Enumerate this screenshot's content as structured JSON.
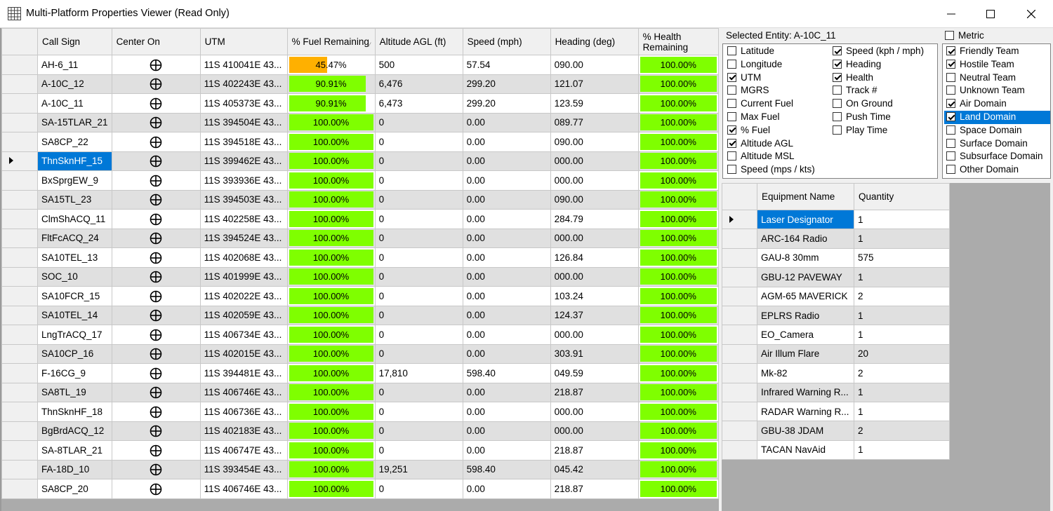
{
  "window": {
    "title": "Multi-Platform Properties Viewer (Read Only)"
  },
  "grid": {
    "columns": [
      "Call Sign",
      "Center On",
      "UTM",
      "% Fuel Remaining",
      "Altitude AGL (ft)",
      "Speed (mph)",
      "Heading (deg)",
      "% Health Remaining"
    ],
    "rows": [
      {
        "call": "AH-6_11",
        "utm": "11S 410041E 43...",
        "fuel_pct": 45.47,
        "fuel": "45.47%",
        "alt": "500",
        "speed": "57.54",
        "heading": "090.00",
        "health_pct": 100,
        "health": "100.00%"
      },
      {
        "call": "A-10C_12",
        "utm": "11S 402243E 43...",
        "fuel_pct": 90.91,
        "fuel": "90.91%",
        "alt": "6,476",
        "speed": "299.20",
        "heading": "121.07",
        "health_pct": 100,
        "health": "100.00%"
      },
      {
        "call": "A-10C_11",
        "utm": "11S 405373E 43...",
        "fuel_pct": 90.91,
        "fuel": "90.91%",
        "alt": "6,473",
        "speed": "299.20",
        "heading": "123.59",
        "health_pct": 100,
        "health": "100.00%"
      },
      {
        "call": "SA-15TLAR_21",
        "utm": "11S 394504E 43...",
        "fuel_pct": 100,
        "fuel": "100.00%",
        "alt": "0",
        "speed": "0.00",
        "heading": "089.77",
        "health_pct": 100,
        "health": "100.00%"
      },
      {
        "call": "SA8CP_22",
        "utm": "11S 394518E 43...",
        "fuel_pct": 100,
        "fuel": "100.00%",
        "alt": "0",
        "speed": "0.00",
        "heading": "090.00",
        "health_pct": 100,
        "health": "100.00%"
      },
      {
        "call": "ThnSknHF_15",
        "utm": "11S 399462E 43...",
        "fuel_pct": 100,
        "fuel": "100.00%",
        "alt": "0",
        "speed": "0.00",
        "heading": "000.00",
        "health_pct": 100,
        "health": "100.00%",
        "selected": true
      },
      {
        "call": "BxSprgEW_9",
        "utm": "11S 393936E 43...",
        "fuel_pct": 100,
        "fuel": "100.00%",
        "alt": "0",
        "speed": "0.00",
        "heading": "000.00",
        "health_pct": 100,
        "health": "100.00%"
      },
      {
        "call": "SA15TL_23",
        "utm": "11S 394503E 43...",
        "fuel_pct": 100,
        "fuel": "100.00%",
        "alt": "0",
        "speed": "0.00",
        "heading": "090.00",
        "health_pct": 100,
        "health": "100.00%"
      },
      {
        "call": "ClmShACQ_11",
        "utm": "11S 402258E 43...",
        "fuel_pct": 100,
        "fuel": "100.00%",
        "alt": "0",
        "speed": "0.00",
        "heading": "284.79",
        "health_pct": 100,
        "health": "100.00%"
      },
      {
        "call": "FltFcACQ_24",
        "utm": "11S 394524E 43...",
        "fuel_pct": 100,
        "fuel": "100.00%",
        "alt": "0",
        "speed": "0.00",
        "heading": "000.00",
        "health_pct": 100,
        "health": "100.00%"
      },
      {
        "call": "SA10TEL_13",
        "utm": "11S 402068E 43...",
        "fuel_pct": 100,
        "fuel": "100.00%",
        "alt": "0",
        "speed": "0.00",
        "heading": "126.84",
        "health_pct": 100,
        "health": "100.00%"
      },
      {
        "call": "SOC_10",
        "utm": "11S 401999E 43...",
        "fuel_pct": 100,
        "fuel": "100.00%",
        "alt": "0",
        "speed": "0.00",
        "heading": "000.00",
        "health_pct": 100,
        "health": "100.00%"
      },
      {
        "call": "SA10FCR_15",
        "utm": "11S 402022E 43...",
        "fuel_pct": 100,
        "fuel": "100.00%",
        "alt": "0",
        "speed": "0.00",
        "heading": "103.24",
        "health_pct": 100,
        "health": "100.00%"
      },
      {
        "call": "SA10TEL_14",
        "utm": "11S 402059E 43...",
        "fuel_pct": 100,
        "fuel": "100.00%",
        "alt": "0",
        "speed": "0.00",
        "heading": "124.37",
        "health_pct": 100,
        "health": "100.00%"
      },
      {
        "call": "LngTrACQ_17",
        "utm": "11S 406734E 43...",
        "fuel_pct": 100,
        "fuel": "100.00%",
        "alt": "0",
        "speed": "0.00",
        "heading": "000.00",
        "health_pct": 100,
        "health": "100.00%"
      },
      {
        "call": "SA10CP_16",
        "utm": "11S 402015E 43...",
        "fuel_pct": 100,
        "fuel": "100.00%",
        "alt": "0",
        "speed": "0.00",
        "heading": "303.91",
        "health_pct": 100,
        "health": "100.00%"
      },
      {
        "call": "F-16CG_9",
        "utm": "11S 394481E 43...",
        "fuel_pct": 100,
        "fuel": "100.00%",
        "alt": "17,810",
        "speed": "598.40",
        "heading": "049.59",
        "health_pct": 100,
        "health": "100.00%"
      },
      {
        "call": "SA8TL_19",
        "utm": "11S 406746E 43...",
        "fuel_pct": 100,
        "fuel": "100.00%",
        "alt": "0",
        "speed": "0.00",
        "heading": "218.87",
        "health_pct": 100,
        "health": "100.00%"
      },
      {
        "call": "ThnSknHF_18",
        "utm": "11S 406736E 43...",
        "fuel_pct": 100,
        "fuel": "100.00%",
        "alt": "0",
        "speed": "0.00",
        "heading": "000.00",
        "health_pct": 100,
        "health": "100.00%"
      },
      {
        "call": "BgBrdACQ_12",
        "utm": "11S 402183E 43...",
        "fuel_pct": 100,
        "fuel": "100.00%",
        "alt": "0",
        "speed": "0.00",
        "heading": "000.00",
        "health_pct": 100,
        "health": "100.00%"
      },
      {
        "call": "SA-8TLAR_21",
        "utm": "11S 406747E 43...",
        "fuel_pct": 100,
        "fuel": "100.00%",
        "alt": "0",
        "speed": "0.00",
        "heading": "218.87",
        "health_pct": 100,
        "health": "100.00%"
      },
      {
        "call": "FA-18D_10",
        "utm": "11S 393454E 43...",
        "fuel_pct": 100,
        "fuel": "100.00%",
        "alt": "19,251",
        "speed": "598.40",
        "heading": "045.42",
        "health_pct": 100,
        "health": "100.00%"
      },
      {
        "call": "SA8CP_20",
        "utm": "11S 406746E 43...",
        "fuel_pct": 100,
        "fuel": "100.00%",
        "alt": "0",
        "speed": "0.00",
        "heading": "218.87",
        "health_pct": 100,
        "health": "100.00%"
      }
    ]
  },
  "colors": {
    "bar_green": "#7fff00",
    "bar_low": "#ffb000",
    "selection": "#0078d7",
    "alt_row": "#e0e0e0",
    "grid_bg": "#ababab"
  },
  "icons": {
    "center_on": "crosshair-circle-icon",
    "app": "grid-window-icon"
  },
  "selected_entity": {
    "label": "Selected Entity: A-10C_11"
  },
  "metric": {
    "label": "Metric",
    "checked": false
  },
  "property_columns": [
    [
      {
        "label": "Latitude",
        "checked": false
      },
      {
        "label": "Longitude",
        "checked": false
      },
      {
        "label": "UTM",
        "checked": true
      },
      {
        "label": "MGRS",
        "checked": false
      },
      {
        "label": "Current Fuel",
        "checked": false
      },
      {
        "label": "Max Fuel",
        "checked": false
      },
      {
        "label": "% Fuel",
        "checked": true
      },
      {
        "label": "Altitude AGL",
        "checked": true
      },
      {
        "label": "Altitude MSL",
        "checked": false
      },
      {
        "label": "Speed (mps / kts)",
        "checked": false
      }
    ],
    [
      {
        "label": "Speed (kph / mph)",
        "checked": true
      },
      {
        "label": "Heading",
        "checked": true
      },
      {
        "label": "Health",
        "checked": true
      },
      {
        "label": "Track #",
        "checked": false
      },
      {
        "label": "On Ground",
        "checked": false
      },
      {
        "label": "Push Time",
        "checked": false
      },
      {
        "label": "Play Time",
        "checked": false
      }
    ]
  ],
  "domains": [
    {
      "label": "Friendly Team",
      "checked": true
    },
    {
      "label": "Hostile Team",
      "checked": true
    },
    {
      "label": "Neutral Team",
      "checked": false
    },
    {
      "label": "Unknown Team",
      "checked": false
    },
    {
      "label": "Air Domain",
      "checked": true
    },
    {
      "label": "Land Domain",
      "checked": true,
      "selected": true
    },
    {
      "label": "Space Domain",
      "checked": false
    },
    {
      "label": "Surface Domain",
      "checked": false
    },
    {
      "label": "Subsurface Domain",
      "checked": false
    },
    {
      "label": "Other Domain",
      "checked": false
    }
  ],
  "equipment": {
    "columns": [
      "Equipment Name",
      "Quantity"
    ],
    "rows": [
      {
        "name": "Laser Designator",
        "qty": "1",
        "selected": true
      },
      {
        "name": "ARC-164 Radio",
        "qty": "1"
      },
      {
        "name": "GAU-8 30mm",
        "qty": "575"
      },
      {
        "name": "GBU-12 PAVEWAY",
        "qty": "1"
      },
      {
        "name": "AGM-65 MAVERICK",
        "qty": "2"
      },
      {
        "name": "EPLRS Radio",
        "qty": "1"
      },
      {
        "name": "EO_Camera",
        "qty": "1"
      },
      {
        "name": "Air Illum Flare",
        "qty": "20"
      },
      {
        "name": "Mk-82",
        "qty": "2"
      },
      {
        "name": "Infrared Warning R...",
        "qty": "1"
      },
      {
        "name": "RADAR Warning R...",
        "qty": "1"
      },
      {
        "name": "GBU-38 JDAM",
        "qty": "2"
      },
      {
        "name": "TACAN NavAid",
        "qty": "1"
      }
    ]
  }
}
